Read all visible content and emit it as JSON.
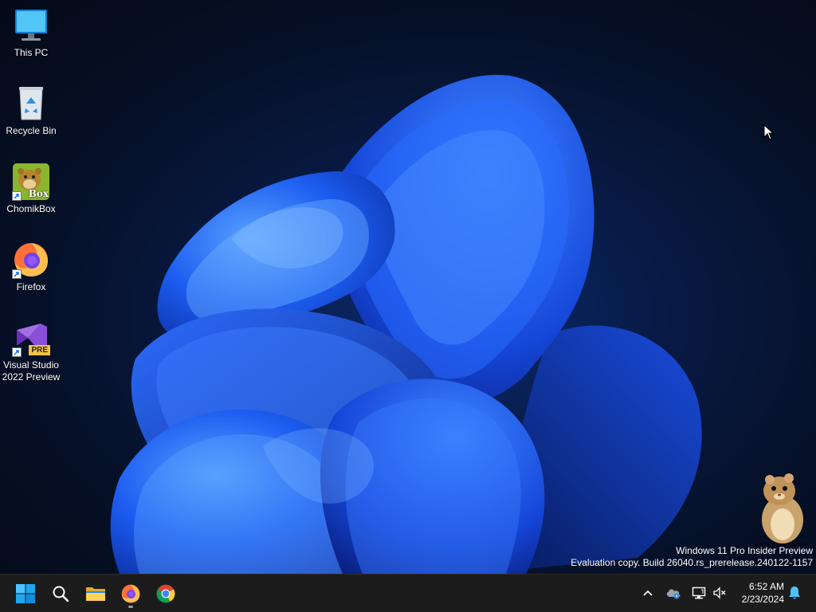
{
  "desktop": {
    "icons": [
      {
        "label": "This PC",
        "icon": "monitor-icon"
      },
      {
        "label": "Recycle Bin",
        "icon": "recycle-bin-icon"
      },
      {
        "label": "ChomikBox",
        "icon": "chomikbox-icon"
      },
      {
        "label": "Firefox",
        "icon": "firefox-icon"
      },
      {
        "label": "Visual Studio\n2022 Preview",
        "icon": "visual-studio-icon",
        "badge": "PRE"
      }
    ],
    "chomik_badge": "Box",
    "watermark": {
      "line1": "Windows 11 Pro Insider Preview",
      "line2": "Evaluation copy. Build 26040.rs_prerelease.240122-1157"
    }
  },
  "taskbar": {
    "apps": [
      {
        "name": "Start",
        "icon": "windows-start-icon"
      },
      {
        "name": "Search",
        "icon": "search-icon"
      },
      {
        "name": "File Explorer",
        "icon": "folder-icon"
      },
      {
        "name": "Firefox",
        "icon": "firefox-icon",
        "running": true
      },
      {
        "name": "Google Chrome",
        "icon": "chrome-icon"
      }
    ],
    "tray": {
      "icons": [
        "chevron-up-icon",
        "onedrive-icon",
        "network-icon",
        "volume-muted-icon",
        "notification-bell-icon"
      ]
    },
    "clock": {
      "time": "6:52 AM",
      "date": "2/23/2024"
    }
  },
  "colors": {
    "taskbar_bg": "#1c1c1c",
    "wallpaper_accent": "#1e5cff"
  }
}
